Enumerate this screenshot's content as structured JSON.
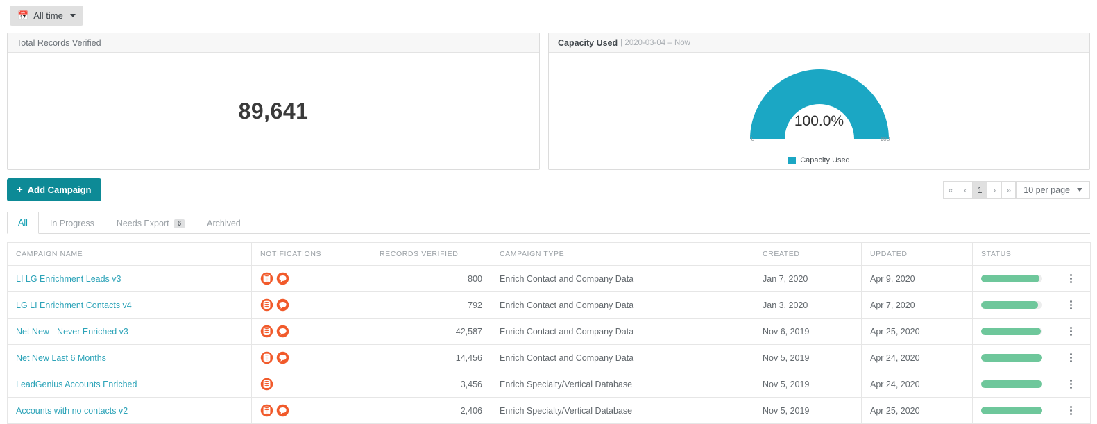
{
  "topbar": {
    "date_filter_label": "All time",
    "calendar_icon": "calendar-icon"
  },
  "panels": {
    "left": {
      "title": "Total Records Verified",
      "value": "89,641"
    },
    "right": {
      "title": "Capacity Used",
      "date_range": "| 2020-03-04 – Now",
      "gauge_label": "100.0%",
      "tick_min": "0",
      "tick_max": "100",
      "legend_label": "Capacity Used"
    }
  },
  "chart_data": {
    "type": "pie",
    "title": "Capacity Used",
    "subtitle": "2020-03-04 – Now",
    "categories": [
      "Capacity Used"
    ],
    "values": [
      100.0
    ],
    "unit": "%",
    "axis_min": 0,
    "axis_max": 100,
    "display_value": "100.0%",
    "colors": [
      "#1ba7c4"
    ],
    "legend": [
      "Capacity Used"
    ],
    "legend_position": "bottom",
    "grid": false
  },
  "actions": {
    "add_campaign_label": "Add Campaign",
    "plus_icon": "plus-icon"
  },
  "pagination": {
    "first_label": "«",
    "prev_label": "‹",
    "current_page": "1",
    "next_label": "›",
    "last_label": "»",
    "per_page_label": "10 per page"
  },
  "tabs": [
    {
      "label": "All",
      "badge": "",
      "active": true
    },
    {
      "label": "In Progress",
      "badge": "",
      "active": false
    },
    {
      "label": "Needs Export",
      "badge": "6",
      "active": false
    },
    {
      "label": "Archived",
      "badge": "",
      "active": false
    }
  ],
  "table": {
    "headers": [
      "CAMPAIGN NAME",
      "NOTIFICATIONS",
      "RECORDS VERIFIED",
      "CAMPAIGN TYPE",
      "CREATED",
      "UPDATED",
      "STATUS",
      ""
    ],
    "rows": [
      {
        "name": "LI LG Enrichment Leads v3",
        "notifications": [
          "database-icon",
          "comment-icon"
        ],
        "records_verified": "800",
        "campaign_type": "Enrich Contact and Company Data",
        "created": "Jan 7, 2020",
        "updated": "Apr 9, 2020",
        "status_percent": 96
      },
      {
        "name": "LG LI Enrichment Contacts v4",
        "notifications": [
          "database-icon",
          "comment-icon"
        ],
        "records_verified": "792",
        "campaign_type": "Enrich Contact and Company Data",
        "created": "Jan 3, 2020",
        "updated": "Apr 7, 2020",
        "status_percent": 93
      },
      {
        "name": "Net New - Never Enriched v3",
        "notifications": [
          "database-icon",
          "comment-icon"
        ],
        "records_verified": "42,587",
        "campaign_type": "Enrich Contact and Company Data",
        "created": "Nov 6, 2019",
        "updated": "Apr 25, 2020",
        "status_percent": 98
      },
      {
        "name": "Net New Last 6 Months",
        "notifications": [
          "database-icon",
          "comment-icon"
        ],
        "records_verified": "14,456",
        "campaign_type": "Enrich Contact and Company Data",
        "created": "Nov 5, 2019",
        "updated": "Apr 24, 2020",
        "status_percent": 100
      },
      {
        "name": "LeadGenius Accounts Enriched",
        "notifications": [
          "database-icon"
        ],
        "records_verified": "3,456",
        "campaign_type": "Enrich Specialty/Vertical Database",
        "created": "Nov 5, 2019",
        "updated": "Apr 24, 2020",
        "status_percent": 100
      },
      {
        "name": "Accounts with no contacts v2",
        "notifications": [
          "database-icon",
          "comment-icon"
        ],
        "records_verified": "2,406",
        "campaign_type": "Enrich Specialty/Vertical Database",
        "created": "Nov 5, 2019",
        "updated": "Apr 25, 2020",
        "status_percent": 100
      }
    ]
  },
  "colors": {
    "accent_teal": "#0d8a96",
    "link_teal": "#2ca3b8",
    "gauge_teal": "#1ba7c4",
    "notification_orange": "#f15a2b",
    "progress_green": "#6ec79b"
  }
}
